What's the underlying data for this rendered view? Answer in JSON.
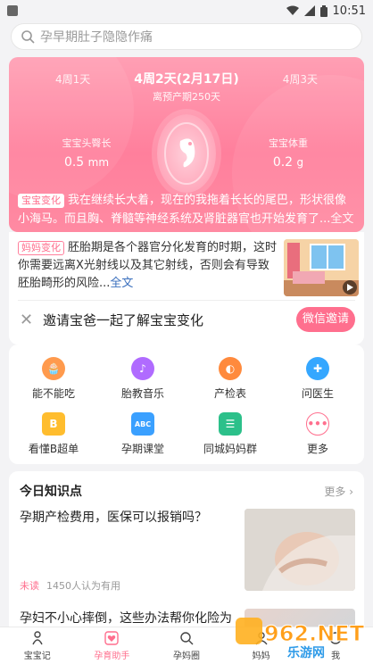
{
  "status_bar": {
    "time": "10:51"
  },
  "search": {
    "placeholder": "孕早期肚子隐隐作痛"
  },
  "hero": {
    "prev_week": "4周1天",
    "current_week": "4周2天(2月17日)",
    "next_week": "4周3天",
    "due_countdown": "离预产期250天",
    "stat_left": {
      "label": "宝宝头臀长",
      "value": "0.5",
      "unit": "mm"
    },
    "stat_right": {
      "label": "宝宝体重",
      "value": "0.2",
      "unit": "g"
    },
    "baby_tag": "宝宝变化",
    "baby_text": "我在继续长大着，现在的我拖着长长的尾巴，形状很像小海马。而且胸、脊髓等神经系统及肾脏器官也开始发育了...",
    "baby_more": "全文"
  },
  "mom": {
    "tag": "妈妈变化",
    "text": "胚胎期是各个器官分化发育的时期，这时你需要远离X光射线以及其它射线，否则会有导致胚胎畸形的风险...",
    "more": "全文"
  },
  "invite": {
    "text": "邀请宝爸一起了解宝宝变化",
    "button": "微信邀请"
  },
  "tools": [
    {
      "label": "能不能吃",
      "icon": "cake-icon",
      "color": "#ff9a4d"
    },
    {
      "label": "胎教音乐",
      "icon": "music-disc-icon",
      "color": "#b06bff"
    },
    {
      "label": "产检表",
      "icon": "checkup-icon",
      "color": "#ff8a3d"
    },
    {
      "label": "问医生",
      "icon": "medical-cross-icon",
      "color": "#35a7ff"
    },
    {
      "label": "看懂B超单",
      "icon": "b-report-icon",
      "color": "#ffbd2e"
    },
    {
      "label": "孕期课堂",
      "icon": "abc-board-icon",
      "color": "#3aa0ff"
    },
    {
      "label": "同城妈妈群",
      "icon": "chat-group-icon",
      "color": "#2cc08a"
    },
    {
      "label": "更多",
      "icon": "more-dots-icon",
      "color": "#ff6f8e"
    }
  ],
  "knowledge": {
    "title": "今日知识点",
    "more": "更多",
    "article1": {
      "title": "孕期产检费用，医保可以报销吗？",
      "unread": "未读",
      "useful": "1450人认为有用"
    },
    "article2": {
      "title": "孕妇不小心摔倒，这些办法帮你化险为"
    }
  },
  "bottom_nav": [
    {
      "label": "宝宝记",
      "icon": "baby-icon",
      "active": false
    },
    {
      "label": "孕育助手",
      "icon": "heart-helper-icon",
      "active": true
    },
    {
      "label": "孕妈圈",
      "icon": "search-circle-icon",
      "active": false
    },
    {
      "label": "妈妈",
      "icon": "mom-icon",
      "active": false
    },
    {
      "label": "我",
      "icon": "me-icon",
      "active": false
    }
  ],
  "watermark": {
    "brand": "962.NET",
    "sub": "乐游网"
  }
}
